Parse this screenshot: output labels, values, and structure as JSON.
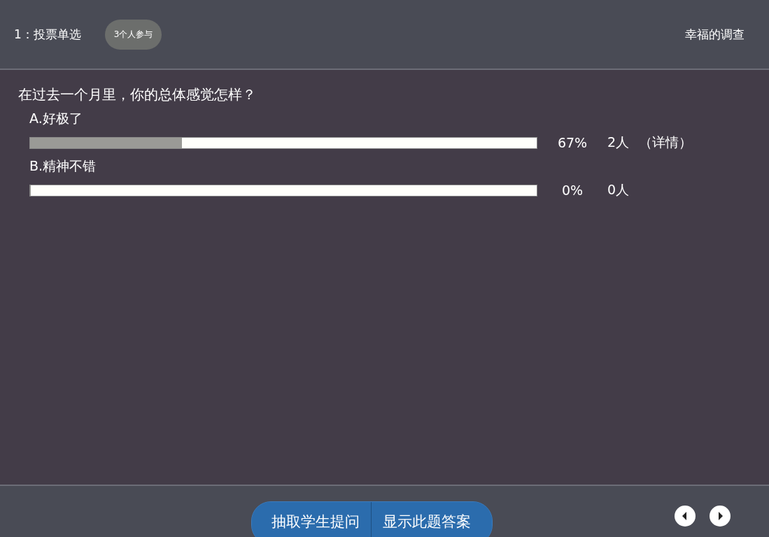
{
  "header": {
    "question_type": "1：投票单选",
    "participants": "3个人参与",
    "survey_title": "幸福的调查"
  },
  "question": "在过去一个月里，你的总体感觉怎样？",
  "options": [
    {
      "label": "A.好极了",
      "level": 0.3,
      "percent": "67%",
      "count": "2人",
      "details": "（详情）"
    },
    {
      "label": "B.精神不错",
      "level": 0,
      "percent": "0%",
      "count": "0人"
    }
  ],
  "footer": {
    "buttons": [
      "抽取学生提问",
      "显示此题答案"
    ]
  }
}
